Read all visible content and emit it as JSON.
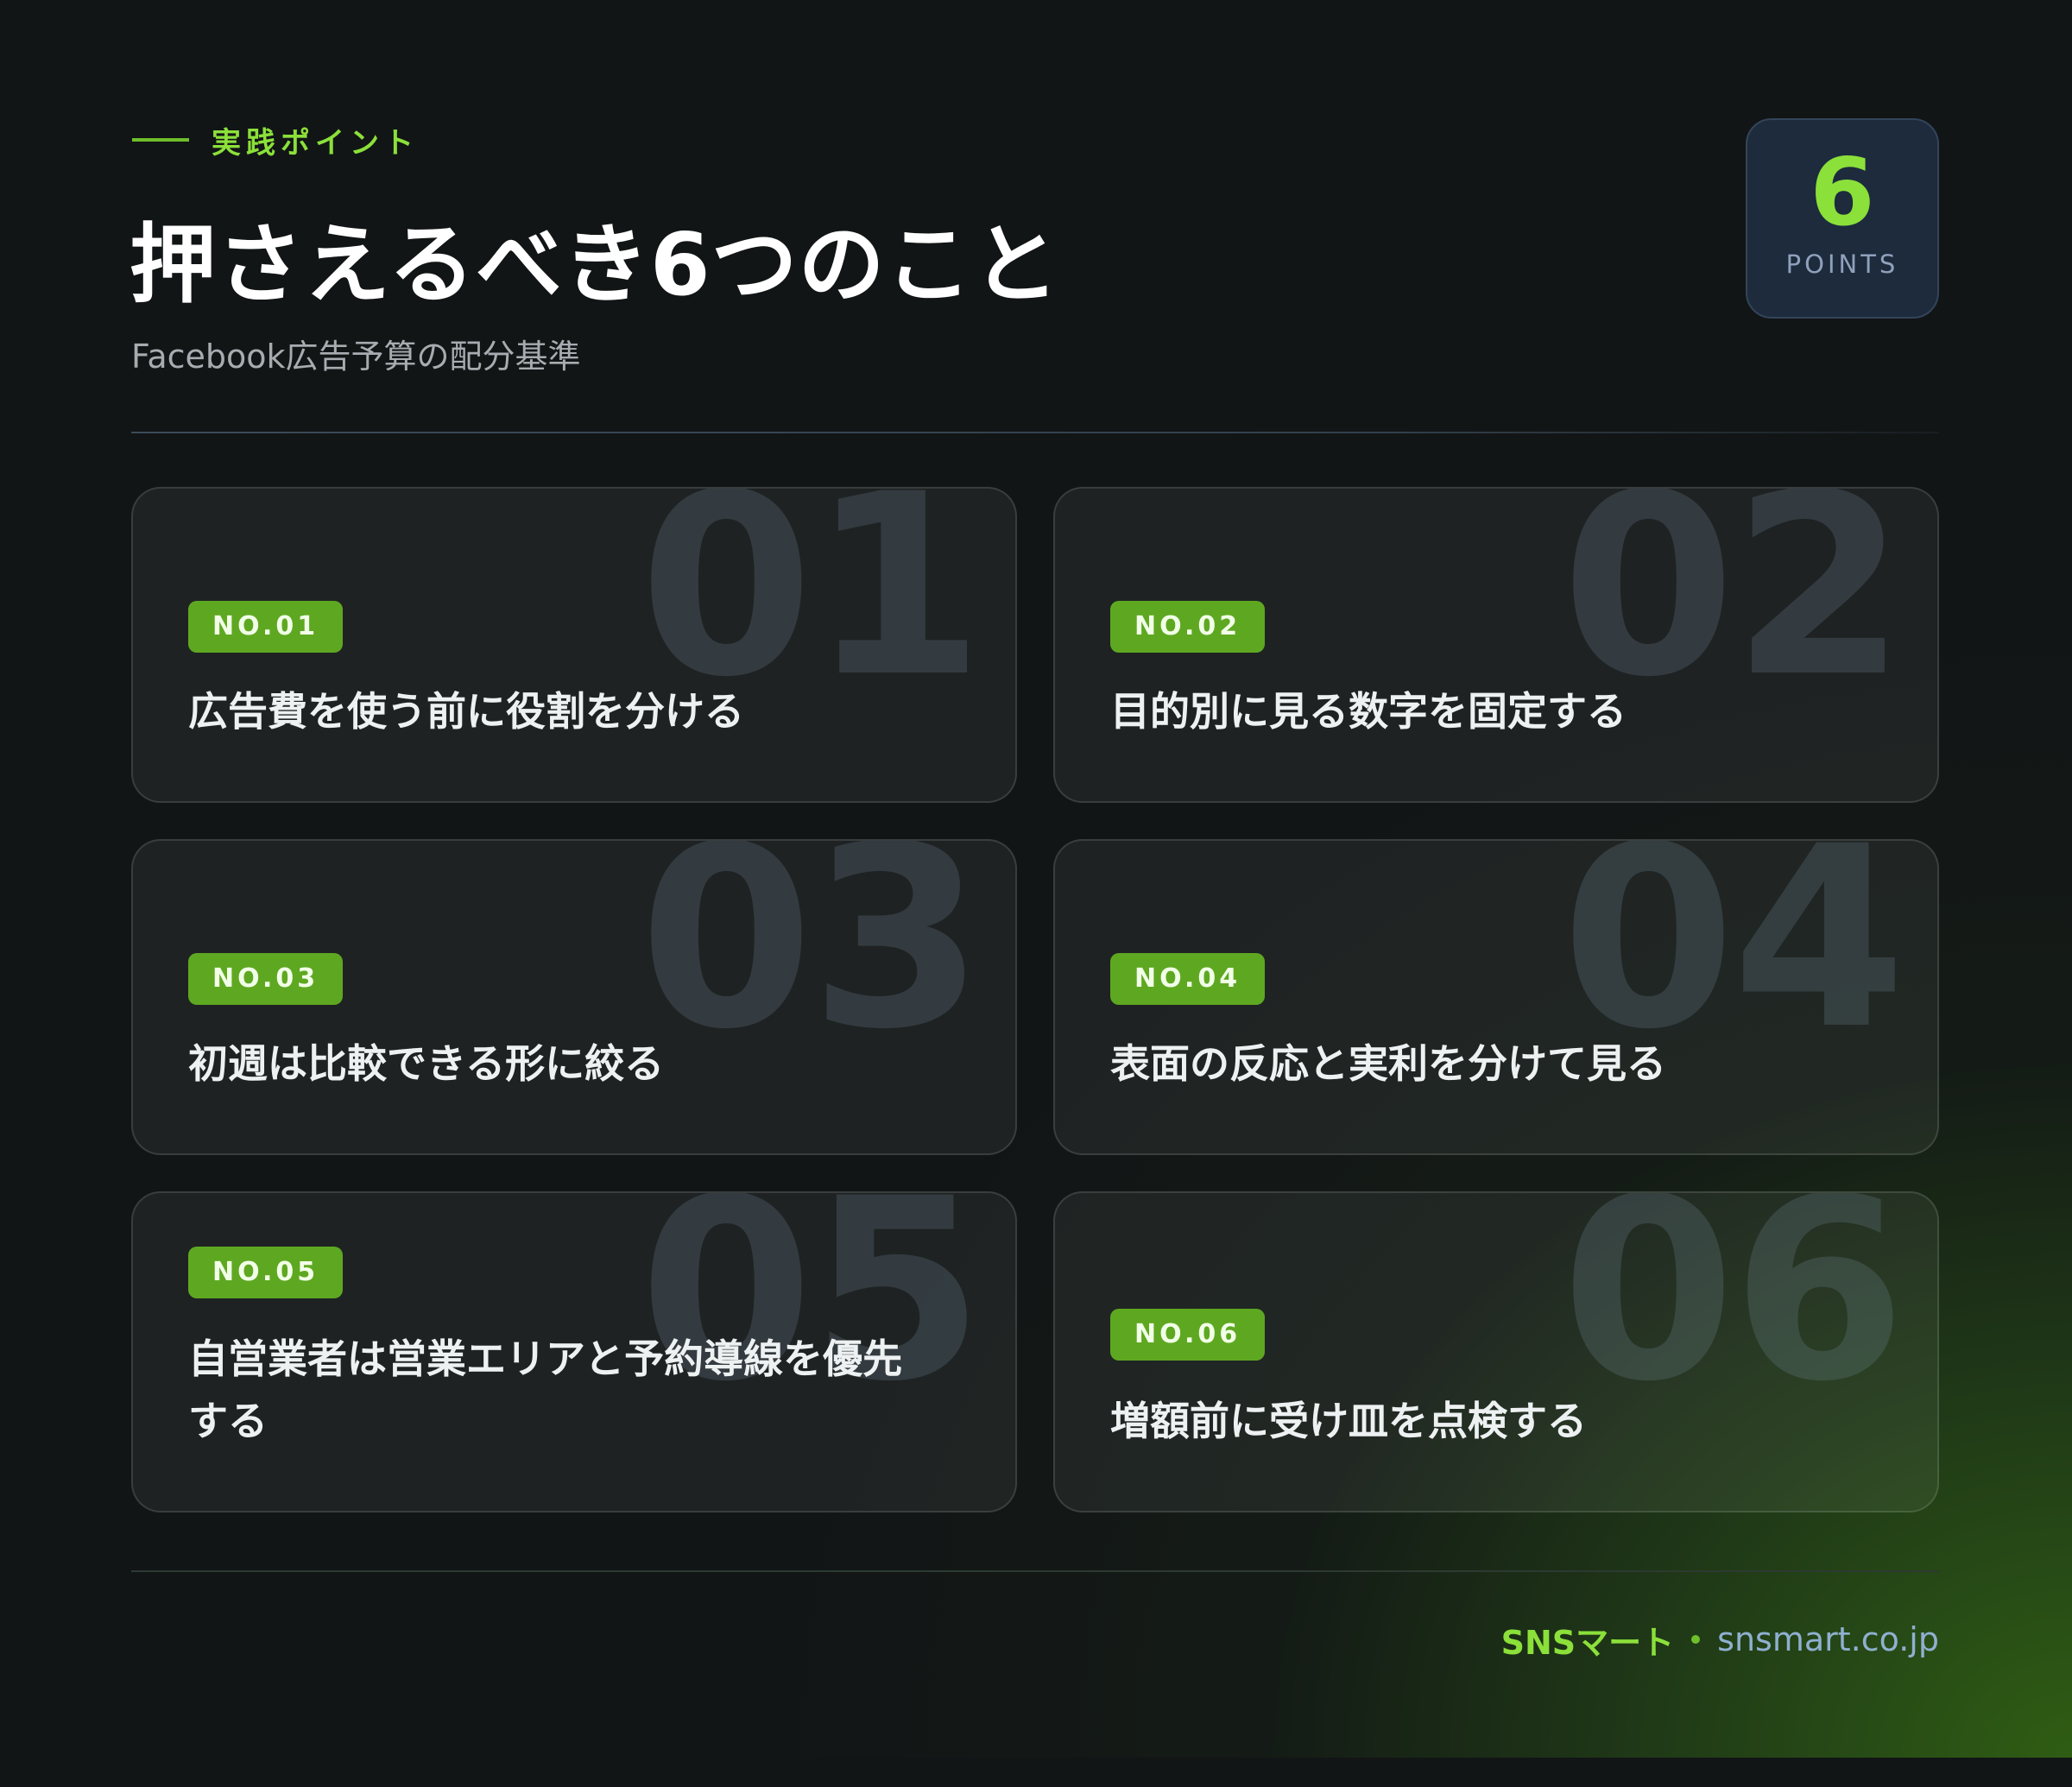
{
  "header": {
    "eyebrow": "実践ポイント",
    "title": "押さえるべき6つのこと",
    "subtitle": "Facebook広告予算の配分基準"
  },
  "badge": {
    "number": "6",
    "label": "POINTS"
  },
  "cards": [
    {
      "big": "01",
      "badge": "NO.01",
      "text": "広告費を使う前に役割を分ける"
    },
    {
      "big": "02",
      "badge": "NO.02",
      "text": "目的別に見る数字を固定する"
    },
    {
      "big": "03",
      "badge": "NO.03",
      "text": "初週は比較できる形に絞る"
    },
    {
      "big": "04",
      "badge": "NO.04",
      "text": "表面の反応と実利を分けて見る"
    },
    {
      "big": "05",
      "badge": "NO.05",
      "text": "自営業者は営業エリアと予約導線を優先する"
    },
    {
      "big": "06",
      "badge": "NO.06",
      "text": "増額前に受け皿を点検する"
    }
  ],
  "footer": {
    "brand": "SNSマート",
    "url": "snsmart.co.jp"
  },
  "colors": {
    "accent": "#8be03a",
    "badge_bg": "#5ea821",
    "background": "#121516"
  }
}
